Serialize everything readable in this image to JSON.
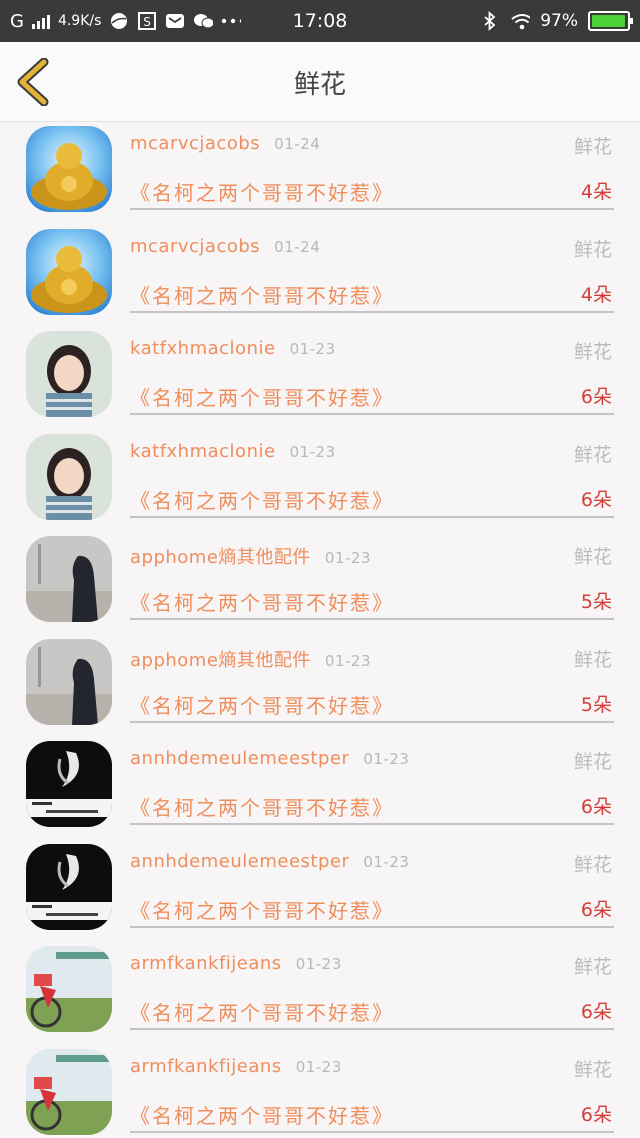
{
  "status_bar": {
    "network": "G",
    "speed": "4.9K/s",
    "time": "17:08",
    "battery": "97%",
    "battery_level": 0.97,
    "icons": [
      "signal-icon",
      "ball-icon",
      "s-app-icon",
      "mail-icon",
      "wechat-icon",
      "more-dots-icon",
      "bluetooth-icon",
      "wifi-icon",
      "battery-icon"
    ]
  },
  "header": {
    "title": "鲜花",
    "back_icon": "chevron-left-icon"
  },
  "records": [
    {
      "name": "mcarvcjacobs",
      "date": "01-24",
      "type": "鲜花",
      "title": "《名柯之两个哥哥不好惹》",
      "count": "4朵",
      "avatar": "buddha"
    },
    {
      "name": "mcarvcjacobs",
      "date": "01-24",
      "type": "鲜花",
      "title": "《名柯之两个哥哥不好惹》",
      "count": "4朵",
      "avatar": "buddha"
    },
    {
      "name": "katfxhmaclonie",
      "date": "01-23",
      "type": "鲜花",
      "title": "《名柯之两个哥哥不好惹》",
      "count": "6朵",
      "avatar": "girl"
    },
    {
      "name": "katfxhmaclonie",
      "date": "01-23",
      "type": "鲜花",
      "title": "《名柯之两个哥哥不好惹》",
      "count": "6朵",
      "avatar": "girl"
    },
    {
      "name": "apphome熵其他配件",
      "date": "01-23",
      "type": "鲜花",
      "title": "《名柯之两个哥哥不好惹》",
      "count": "5朵",
      "avatar": "hood"
    },
    {
      "name": "apphome熵其他配件",
      "date": "01-23",
      "type": "鲜花",
      "title": "《名柯之两个哥哥不好惹》",
      "count": "5朵",
      "avatar": "hood"
    },
    {
      "name": "annhdemeulemeestper",
      "date": "01-23",
      "type": "鲜花",
      "title": "《名柯之两个哥哥不好惹》",
      "count": "6朵",
      "avatar": "dark"
    },
    {
      "name": "annhdemeulemeestper",
      "date": "01-23",
      "type": "鲜花",
      "title": "《名柯之两个哥哥不好惹》",
      "count": "6朵",
      "avatar": "dark"
    },
    {
      "name": "armfkankfijeans",
      "date": "01-23",
      "type": "鲜花",
      "title": "《名柯之两个哥哥不好惹》",
      "count": "6朵",
      "avatar": "bike"
    },
    {
      "name": "armfkankfijeans",
      "date": "01-23",
      "type": "鲜花",
      "title": "《名柯之两个哥哥不好惹》",
      "count": "6朵",
      "avatar": "bike"
    }
  ],
  "colors": {
    "name": "#ef8e5c",
    "count": "#d23f3a",
    "muted": "#bcbcbc",
    "back": "#e2b23a"
  }
}
